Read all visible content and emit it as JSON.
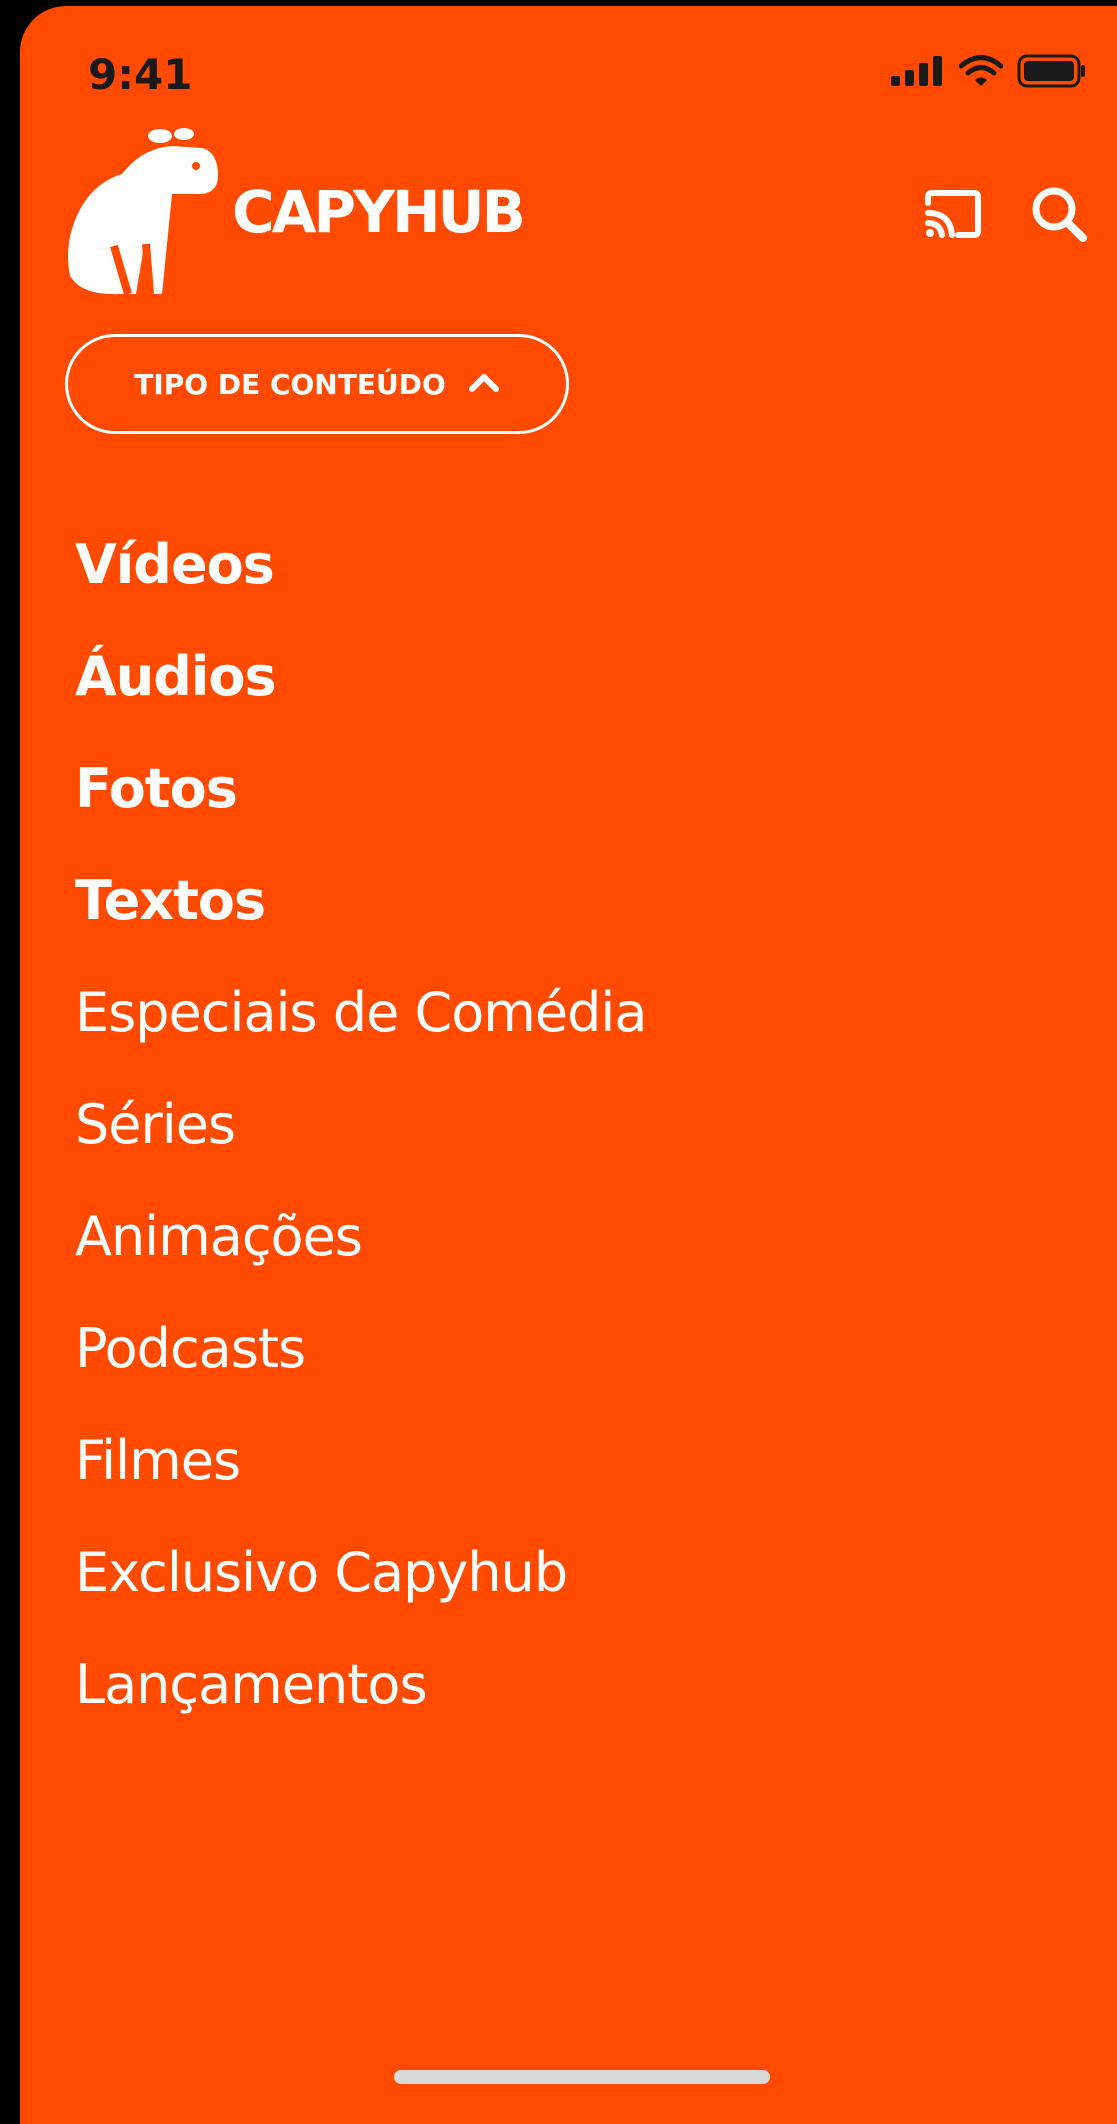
{
  "status_bar": {
    "time": "9:41"
  },
  "brand": {
    "name": "Capyhub",
    "wordmark": "CAPYHUB",
    "color": "#FF4A00"
  },
  "header": {
    "cast_icon": "cast-icon",
    "search_icon": "search-icon"
  },
  "filter": {
    "label": "TIPO DE CONTEÚDO",
    "icon": "chevron-up-icon",
    "expanded": true
  },
  "menu": {
    "items": [
      {
        "label": "Vídeos",
        "bold": true
      },
      {
        "label": "Áudios",
        "bold": true
      },
      {
        "label": "Fotos",
        "bold": true
      },
      {
        "label": "Textos",
        "bold": true
      },
      {
        "label": "Especiais de Comédia",
        "bold": false
      },
      {
        "label": "Séries",
        "bold": false
      },
      {
        "label": "Animações",
        "bold": false
      },
      {
        "label": "Podcasts",
        "bold": false
      },
      {
        "label": "Filmes",
        "bold": false
      },
      {
        "label": "Exclusivo Capyhub",
        "bold": false
      },
      {
        "label": "Lançamentos",
        "bold": false
      }
    ]
  }
}
